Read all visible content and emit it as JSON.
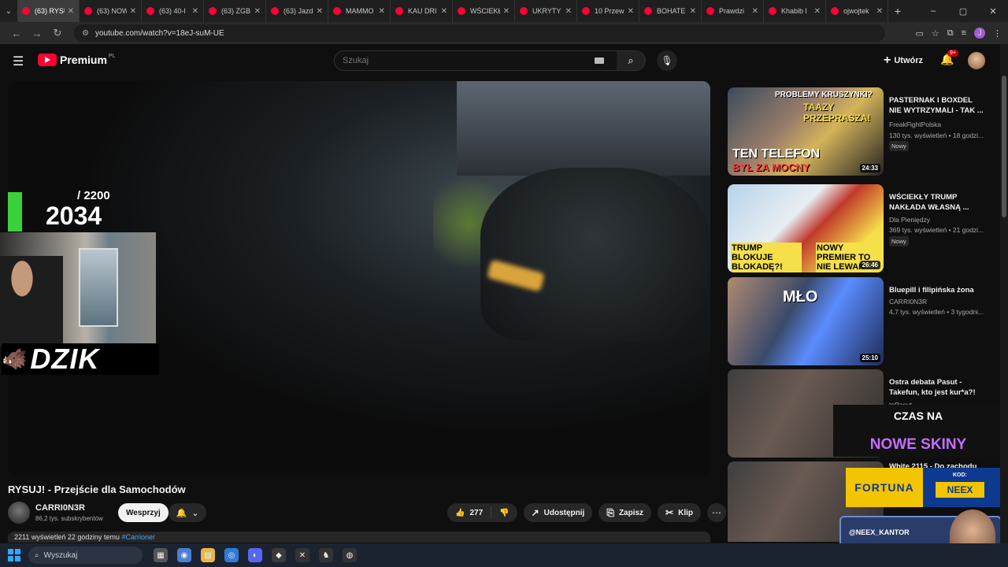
{
  "tabs": [
    {
      "label": "(63) RYSU"
    },
    {
      "label": "(63) NOW"
    },
    {
      "label": "(63) 40-l"
    },
    {
      "label": "(63) ZGB"
    },
    {
      "label": "(63) Jazd"
    },
    {
      "label": "MAMMO"
    },
    {
      "label": "KAU DRI"
    },
    {
      "label": "WŚCIEKŁ"
    },
    {
      "label": "UKRYTY"
    },
    {
      "label": "10 Przew"
    },
    {
      "label": "BOHATE"
    },
    {
      "label": "Prawdzi"
    },
    {
      "label": "Khabib l"
    },
    {
      "label": "ojwojtek"
    }
  ],
  "address": {
    "url": "youtube.com/watch?v=18eJ-suM-UE"
  },
  "yt": {
    "brand": "Premium",
    "region": "PL",
    "search_placeholder": "Szukaj",
    "create_label": "Utwórz",
    "notif_count": "9+"
  },
  "overlay": {
    "counter_max": "/ 2200",
    "counter_value": "2034",
    "dzik": "DZIK"
  },
  "video": {
    "title": "RYSUJ! - Przejście dla Samochodów",
    "channel": "CARRI0N3R",
    "subs": "86,2 tys. subskrybentów",
    "support": "Wesprzyj",
    "likes": "277",
    "share": "Udostępnij",
    "save": "Zapisz",
    "clip": "Klip",
    "desc_views": "2211 wyświetleń  22 godziny temu",
    "desc_tag": "#Carrioner"
  },
  "sidebar": [
    {
      "title": "PASTERNAK I BOXDEL NIE WYTRZYMALI - TAK ...",
      "channel": "FreakFightPolska",
      "meta": "130 tys. wyświetleń • 18 godzi...",
      "badge": "Nowy",
      "duration": "24:33",
      "thumb_text1": "PROBLEMY KRUSZYNKI?",
      "thumb_text2": "TAAZY PRZEPRASZA!",
      "thumb_text3": "TEN TELEFON",
      "thumb_text4": "BYŁ ZA MOCNY"
    },
    {
      "title": "WŚCIEKŁY TRUMP NAKŁADA WŁASNĄ ...",
      "channel": "Dla Pieniędzy",
      "meta": "369 tys. wyświetleń • 21 godzi...",
      "badge": "Nowy",
      "duration": "26:46",
      "thumb_text1": "TRUMP BLOKUJE BLOKADĘ?!",
      "thumb_text2": "NOWY PREMIER TO NIE LEWAK"
    },
    {
      "title": "Bluepill i filipińska żona",
      "channel": "CARRI0N3R",
      "meta": "4,7 tys. wyświetleń • 3 tygodni...",
      "duration": "25:10",
      "thumb_text1": "MŁO"
    },
    {
      "title": "Ostra debata Pasut - Takefun, kto jest kur*a?!",
      "channel": "toPasut"
    },
    {
      "title": "White 2115 - Do zachodu"
    }
  ],
  "streamer_overlays": {
    "skins_top": "CZAS NA",
    "skins_bottom": "NOWE SKINY",
    "fortuna": "FORTUNA",
    "kod_label": "KOD:",
    "kod_value": "NEEX",
    "kantor": "@NEEX_KANTOR"
  },
  "taskbar": {
    "search": "Wyszukaj"
  }
}
